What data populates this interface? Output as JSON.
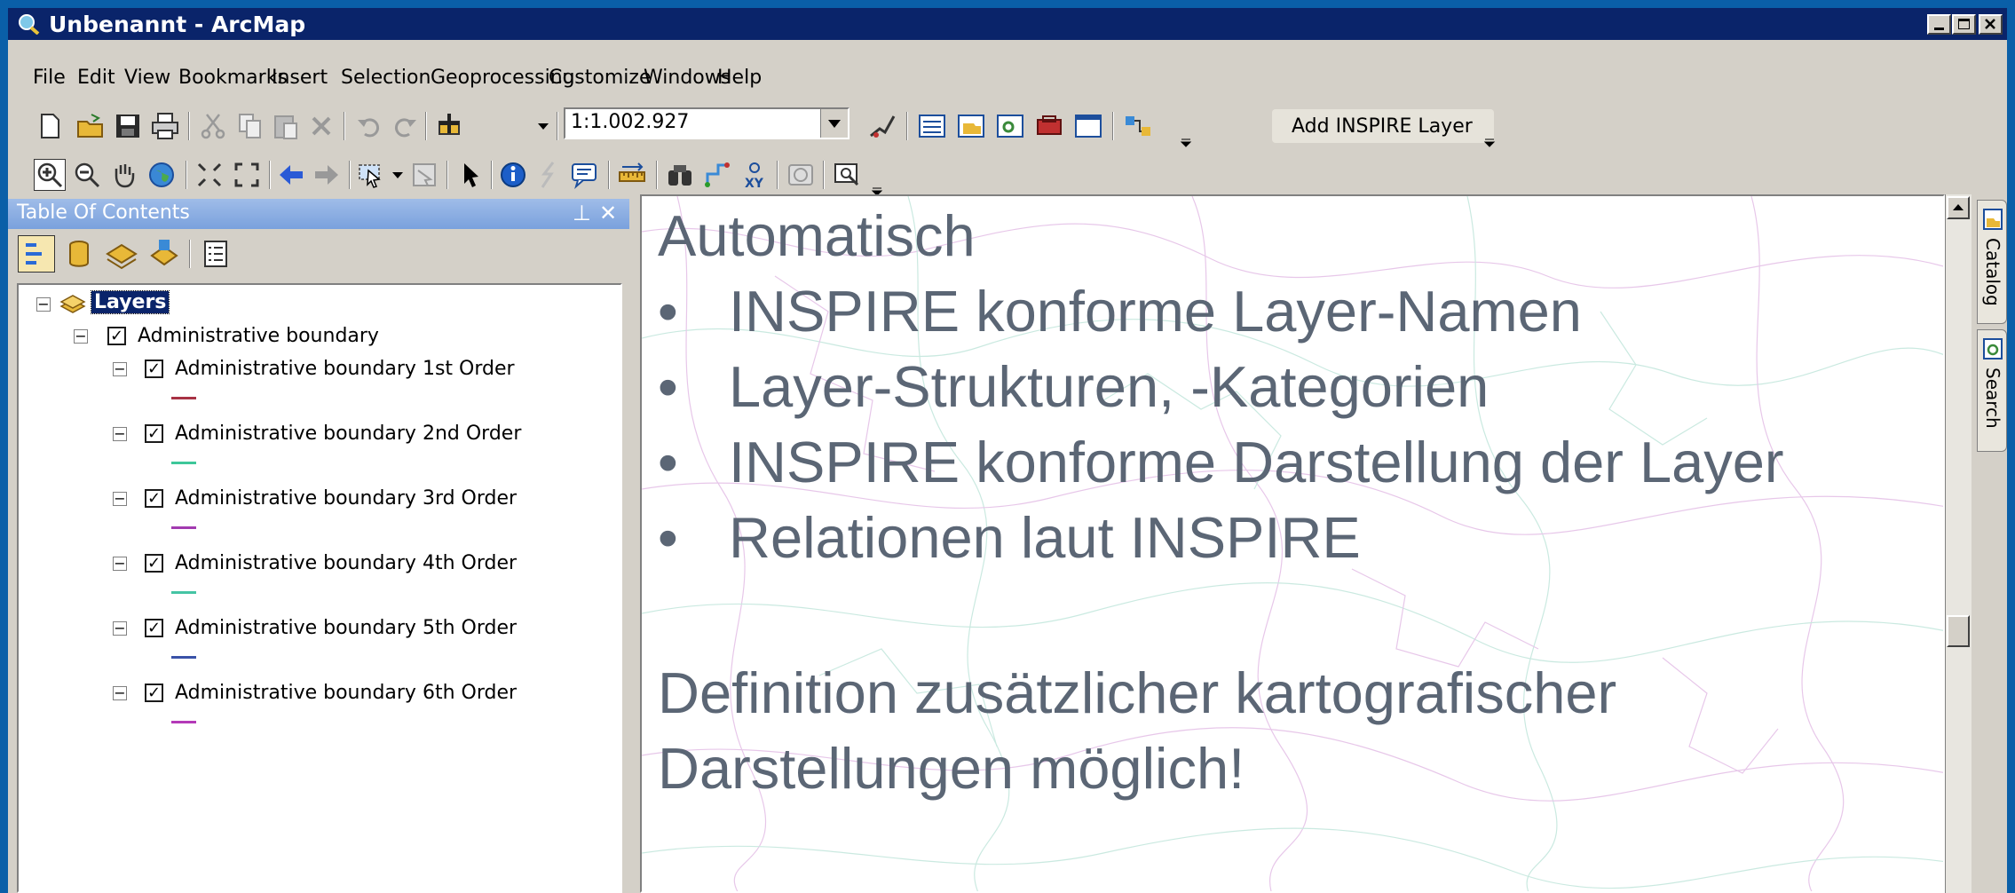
{
  "window": {
    "title": "Unbenannt - ArcMap"
  },
  "menu": [
    "File",
    "Edit",
    "View",
    "Bookmarks",
    "Insert",
    "Selection",
    "Geoprocessing",
    "Customize",
    "Windows",
    "Help"
  ],
  "toolbar": {
    "scale_value": "1:1.002.927",
    "add_inspire_label": "Add INSPIRE Layer"
  },
  "toc": {
    "title": "Table Of Contents",
    "root": "Layers",
    "group": "Administrative boundary",
    "layers": [
      {
        "label": "Administrative boundary 1st Order",
        "color": "#a83244"
      },
      {
        "label": "Administrative boundary 2nd Order",
        "color": "#3ec79a"
      },
      {
        "label": "Administrative boundary 3rd Order",
        "color": "#a23bb0"
      },
      {
        "label": "Administrative boundary 4th Order",
        "color": "#45c4a4"
      },
      {
        "label": "Administrative boundary 5th Order",
        "color": "#3a52a8"
      },
      {
        "label": "Administrative boundary 6th Order",
        "color": "#b43ab8"
      }
    ]
  },
  "slide": {
    "heading": "Automatisch",
    "bullets": [
      "INSPIRE konforme Layer-Namen",
      "Layer-Strukturen, -Kategorien",
      "INSPIRE konforme Darstellung der Layer",
      "Relationen laut INSPIRE"
    ],
    "footer_line1": "Definition zusätzlicher kartografischer",
    "footer_line2": "Darstellungen möglich!"
  },
  "side_tabs": [
    "Catalog",
    "Search"
  ],
  "colors": {
    "titlebar": "#0a246a",
    "desktop": "#0a5fa8",
    "toc_header": "#7aa1dd",
    "slide_text": "#5b6675"
  }
}
